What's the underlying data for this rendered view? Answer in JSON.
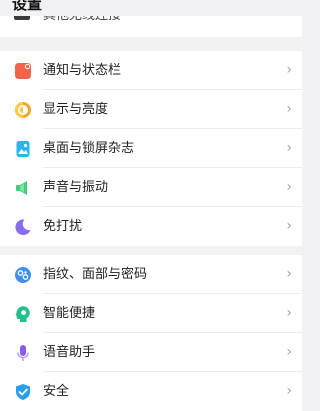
{
  "header": {
    "title": "设置"
  },
  "partial_item": {
    "label": "其他无线连接"
  },
  "groups": [
    {
      "items": [
        {
          "label": "通知与状态栏",
          "icon": "notification-icon",
          "chevron": "›"
        },
        {
          "label": "显示与亮度",
          "icon": "display-brightness-icon",
          "chevron": "›"
        },
        {
          "label": "桌面与锁屏杂志",
          "icon": "wallpaper-icon",
          "chevron": "›"
        },
        {
          "label": "声音与振动",
          "icon": "speaker-icon",
          "chevron": "›"
        },
        {
          "label": "免打扰",
          "icon": "moon-icon",
          "chevron": "›"
        }
      ]
    },
    {
      "items": [
        {
          "label": "指纹、面部与密码",
          "icon": "fingerprint-face-icon",
          "chevron": "›"
        },
        {
          "label": "智能便捷",
          "icon": "smart-assist-icon",
          "chevron": "›"
        },
        {
          "label": "语音助手",
          "icon": "microphone-icon",
          "chevron": "›"
        },
        {
          "label": "安全",
          "icon": "shield-check-icon",
          "chevron": "›"
        }
      ]
    }
  ],
  "colors": {
    "notification": "#f0654c",
    "display": "#f5a623",
    "wallpaper": "#29b6e8",
    "sound": "#3fcf7a",
    "dnd": "#8b6cf0",
    "fingerprint": "#3f8ef5",
    "smart": "#22c08f",
    "voice": "#8a5cf5",
    "security": "#2c9ef2"
  }
}
